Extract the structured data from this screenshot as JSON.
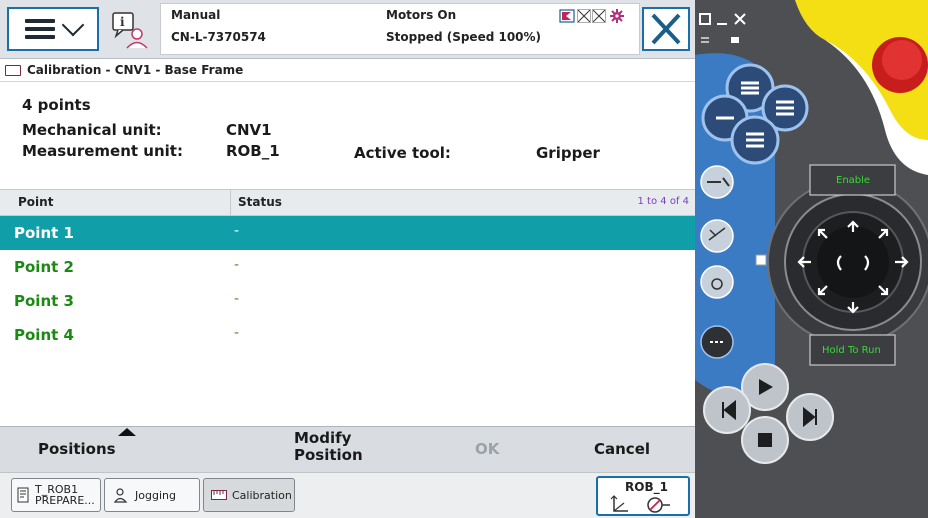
{
  "status": {
    "mode": "Manual",
    "controller": "CN-L-7370574",
    "motors": "Motors On",
    "state": "Stopped (Speed 100%)"
  },
  "window_title": "Calibration - CNV1 - Base Frame",
  "info": {
    "points_count": "4 points",
    "mech_label": "Mechanical unit:",
    "mech_value": "CNV1",
    "meas_label": "Measurement unit:",
    "meas_value": "ROB_1",
    "tool_label": "Active tool:",
    "tool_value": "Gripper"
  },
  "table": {
    "col_point": "Point",
    "col_status": "Status",
    "range": "1 to 4 of 4",
    "rows": [
      {
        "point": "Point  1",
        "status": "-"
      },
      {
        "point": "Point  2",
        "status": "-"
      },
      {
        "point": "Point  3",
        "status": "-"
      },
      {
        "point": "Point  4",
        "status": "-"
      }
    ],
    "selected_index": 0
  },
  "actions": {
    "positions": "Positions",
    "modify_line1": "Modify",
    "modify_line2": "Position",
    "ok": "OK",
    "cancel": "Cancel"
  },
  "taskbar": {
    "task1_line1": "T_ROB1",
    "task1_line2": "PREPARE...",
    "jogging": "Jogging",
    "calibration": "Calibration",
    "rob": "ROB_1"
  },
  "pendant": {
    "enable": "Enable",
    "hold_to_run": "Hold To Run"
  },
  "colors": {
    "selected_row": "#109fa8",
    "point_text": "#1b8a12",
    "accent_border": "#1a6fa8",
    "pendant_green_text": "#33dd33"
  }
}
